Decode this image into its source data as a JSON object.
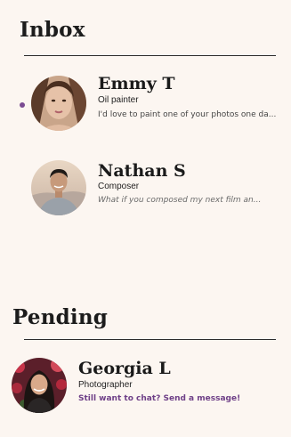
{
  "inbox": {
    "title": "Inbox",
    "conversations": [
      {
        "name": "Emmy T",
        "role": "Oil painter",
        "preview": "I'd love to paint one of your photos one da...",
        "unread": true
      },
      {
        "name": "Nathan S",
        "role": "Composer",
        "preview": "What if you composed my next film an...",
        "unread": false
      }
    ]
  },
  "pending": {
    "title": "Pending",
    "requests": [
      {
        "name": "Georgia L",
        "role": "Photographer",
        "preview": "Still want to chat? Send a message!"
      }
    ]
  },
  "colors": {
    "background": "#fcf6f1",
    "accent": "#7b4b92"
  }
}
